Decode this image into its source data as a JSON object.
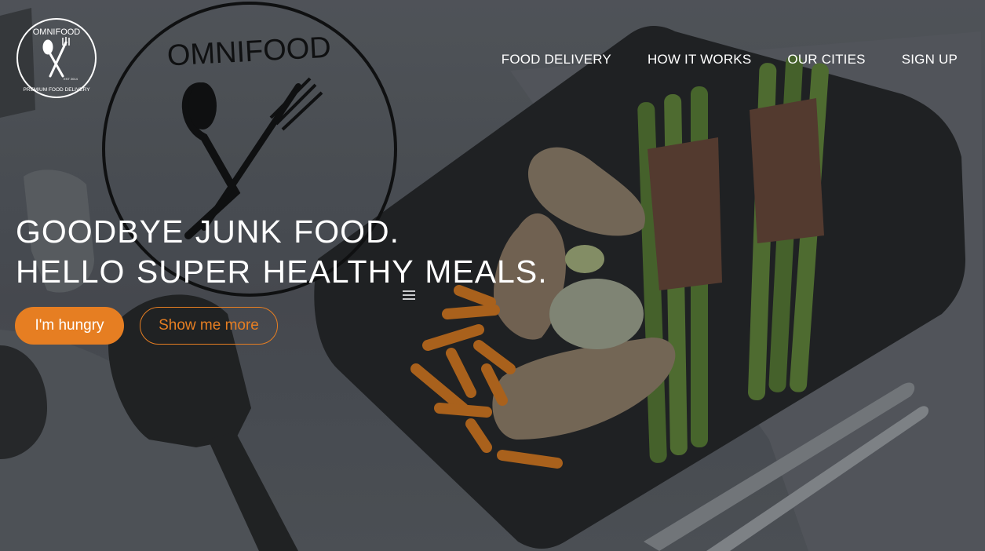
{
  "brand": {
    "logo_text_top": "OMNIFOOD",
    "logo_text_bottom": "PREMIUM FOOD DELIVERY",
    "logo_est": "EST 2014"
  },
  "nav": {
    "items": [
      {
        "label": "FOOD DELIVERY"
      },
      {
        "label": "HOW IT WORKS"
      },
      {
        "label": "OUR CITIES"
      },
      {
        "label": "SIGN UP"
      }
    ]
  },
  "hero": {
    "headline_line1": "GOODBYE JUNK FOOD.",
    "headline_line2": "HELLO SUPER HEALTHY MEALS.",
    "primary_button": "I'm hungry",
    "secondary_button": "Show me more",
    "watermark_top": "OMNIFOOD"
  },
  "colors": {
    "accent": "#e67e22",
    "text": "#ffffff",
    "overlay": "#4b4f55"
  },
  "icons": {
    "menu": "menu-icon",
    "logo": "spoon-fork-icon"
  }
}
